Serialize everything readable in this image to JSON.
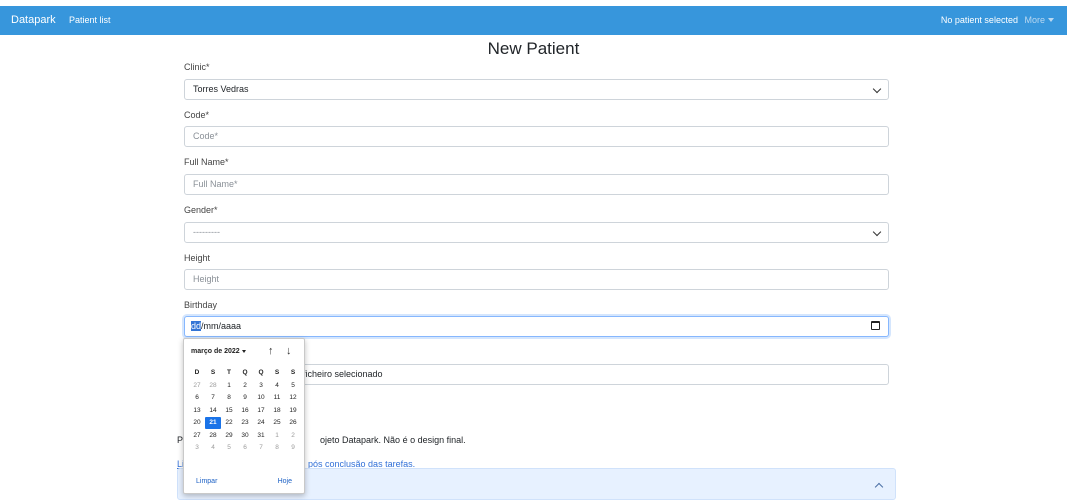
{
  "navbar": {
    "brand": "Datapark",
    "patient_list": "Patient list",
    "status": "No patient selected",
    "more": "More"
  },
  "page": {
    "title": "New Patient"
  },
  "form": {
    "clinic": {
      "label": "Clinic*",
      "value": "Torres Vedras"
    },
    "code": {
      "label": "Code*",
      "placeholder": "Code*"
    },
    "full_name": {
      "label": "Full Name*",
      "placeholder": "Full Name*"
    },
    "gender": {
      "label": "Gender*",
      "value": "---------"
    },
    "height": {
      "label": "Height",
      "placeholder": "Height"
    },
    "birthday": {
      "label": "Birthday",
      "day_part": "dd",
      "rest": "/mm/aaaa"
    },
    "file": {
      "text": "ficheiro selecionado"
    }
  },
  "footer": {
    "text_prefix": "P",
    "text_suffix": "ojeto Datapark. Não é o design final.",
    "link_prefix": "Li",
    "link_suffix": "pós conclusão das tarefas."
  },
  "datepicker": {
    "month_label": "março de 2022",
    "prev_arrow": "↑",
    "next_arrow": "↓",
    "weekdays": [
      "D",
      "S",
      "T",
      "Q",
      "Q",
      "S",
      "S"
    ],
    "weeks": [
      [
        {
          "d": "27",
          "m": true
        },
        {
          "d": "28",
          "m": true
        },
        {
          "d": "1"
        },
        {
          "d": "2"
        },
        {
          "d": "3"
        },
        {
          "d": "4"
        },
        {
          "d": "5"
        }
      ],
      [
        {
          "d": "6"
        },
        {
          "d": "7"
        },
        {
          "d": "8"
        },
        {
          "d": "9"
        },
        {
          "d": "10"
        },
        {
          "d": "11"
        },
        {
          "d": "12"
        }
      ],
      [
        {
          "d": "13"
        },
        {
          "d": "14"
        },
        {
          "d": "15"
        },
        {
          "d": "16"
        },
        {
          "d": "17"
        },
        {
          "d": "18"
        },
        {
          "d": "19"
        }
      ],
      [
        {
          "d": "20"
        },
        {
          "d": "21",
          "s": true
        },
        {
          "d": "22"
        },
        {
          "d": "23"
        },
        {
          "d": "24"
        },
        {
          "d": "25"
        },
        {
          "d": "26"
        }
      ],
      [
        {
          "d": "27"
        },
        {
          "d": "28"
        },
        {
          "d": "29"
        },
        {
          "d": "30"
        },
        {
          "d": "31"
        },
        {
          "d": "1",
          "m": true
        },
        {
          "d": "2",
          "m": true
        }
      ],
      [
        {
          "d": "3",
          "m": true
        },
        {
          "d": "4",
          "m": true
        },
        {
          "d": "5",
          "m": true
        },
        {
          "d": "6",
          "m": true
        },
        {
          "d": "7",
          "m": true
        },
        {
          "d": "8",
          "m": true
        },
        {
          "d": "9",
          "m": true
        }
      ]
    ],
    "clear_label": "Limpar",
    "today_label": "Hoje"
  },
  "colors": {
    "navbar": "#3796dc",
    "accent": "#1a73e8",
    "accordion": "#e7f1ff"
  }
}
